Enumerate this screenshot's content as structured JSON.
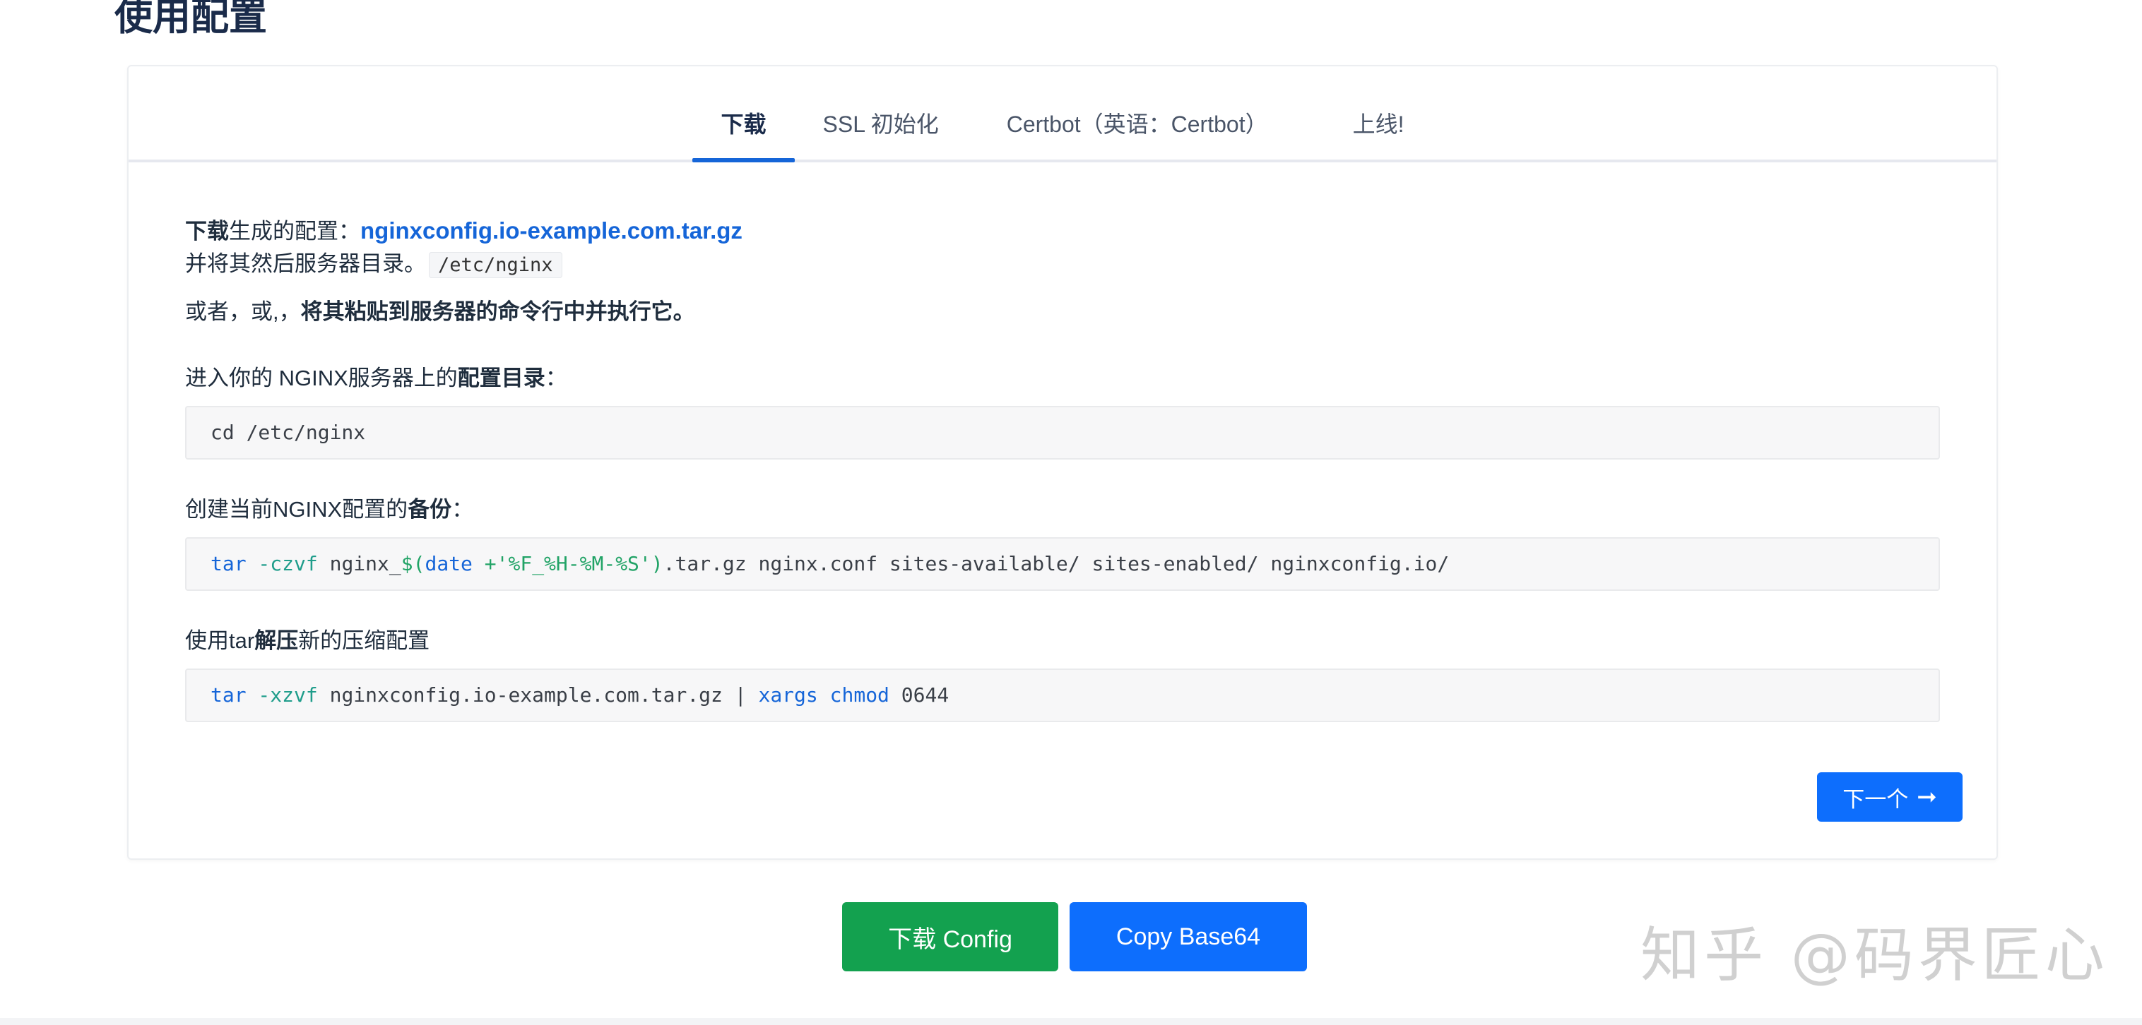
{
  "page": {
    "title": "使用配置"
  },
  "tabs": [
    {
      "label": "下载",
      "active": true
    },
    {
      "label": "SSL 初始化",
      "active": false
    },
    {
      "label": "Certbot（英语：Certbot）",
      "active": false
    },
    {
      "label": "上线!",
      "active": false
    }
  ],
  "download": {
    "bold_prefix": "下载",
    "text_after_prefix": "生成的配置：",
    "file_link": "nginxconfig.io-example.com.tar.gz",
    "line2_text": "并将其然后服务器目录。",
    "dir_code": "/etc/nginx",
    "alt_prefix": "或者，或,，",
    "alt_bold": "将其粘贴到服务器的命令行中并执行它。"
  },
  "steps": {
    "cd_label_prefix": "进入你的 NGINX服务器上的",
    "cd_label_bold": "配置目录",
    "cd_label_suffix": "：",
    "cd_command": "cd /etc/nginx",
    "backup_label_prefix": "创建当前NGINX配置的",
    "backup_label_bold": "备份",
    "backup_label_suffix": "：",
    "backup_cmd": {
      "tar": "tar",
      "opt": " -czvf",
      "p1": " nginx_",
      "sub_open": "$(",
      "date": "date",
      "str": " +'%F_%H-%M-%S')",
      "rest": ".tar.gz nginx.conf sites-available/ sites-enabled/ nginxconfig.io/"
    },
    "extract_label_prefix": "使用tar",
    "extract_label_bold": "解压",
    "extract_label_suffix": "新的压缩配置",
    "extract_cmd": {
      "tar": "tar",
      "opt": " -xzvf",
      "file": " nginxconfig.io-example.com.tar.gz | ",
      "xargs": "xargs",
      "space": " ",
      "chmod": "chmod",
      "mode": " 0644"
    }
  },
  "buttons": {
    "next_label": "下一个",
    "next_arrow": "➞",
    "download_config": "下载 Config",
    "copy_base64": "Copy Base64"
  },
  "watermark": "知乎 @码界匠心",
  "colors": {
    "accent": "#1565d8",
    "primary_button": "#0d6efd",
    "success_button": "#13a14f"
  }
}
